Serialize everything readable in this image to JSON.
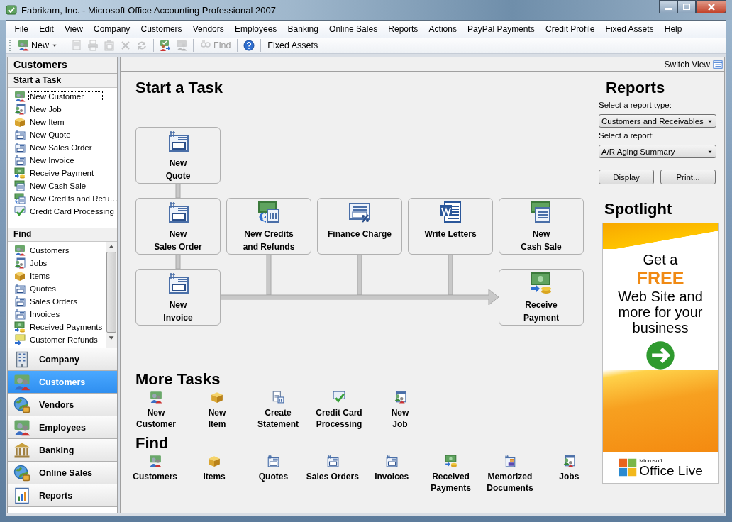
{
  "window": {
    "title": "Fabrikam, Inc. - Microsoft Office Accounting Professional 2007"
  },
  "menu": [
    "File",
    "Edit",
    "View",
    "Company",
    "Customers",
    "Vendors",
    "Employees",
    "Banking",
    "Online Sales",
    "Reports",
    "Actions",
    "PayPal Payments",
    "Credit Profile",
    "Fixed Assets",
    "Help"
  ],
  "toolbar": [
    {
      "kind": "button",
      "label": "New",
      "dropdown": true,
      "disabled": false
    },
    {
      "kind": "separator"
    },
    {
      "kind": "icon",
      "disabled": true
    },
    {
      "kind": "icon",
      "disabled": true
    },
    {
      "kind": "icon",
      "disabled": true
    },
    {
      "kind": "icon",
      "disabled": true
    },
    {
      "kind": "icon",
      "disabled": true
    },
    {
      "kind": "separator"
    },
    {
      "kind": "icon",
      "disabled": false
    },
    {
      "kind": "icon",
      "disabled": true
    },
    {
      "kind": "separator"
    },
    {
      "kind": "button",
      "label": "Find",
      "dropdown": false,
      "disabled": true
    },
    {
      "kind": "separator"
    },
    {
      "kind": "icon",
      "disabled": false
    },
    {
      "kind": "separator"
    },
    {
      "kind": "button",
      "label": "Fixed Assets",
      "dropdown": false,
      "disabled": false
    }
  ],
  "sidebar": {
    "title": "Customers",
    "start_a_task": {
      "heading": "Start a Task",
      "items": [
        {
          "label": "New Customer",
          "selected": true
        },
        {
          "label": "New Job",
          "selected": false
        },
        {
          "label": "New Item",
          "selected": false
        },
        {
          "label": "New Quote",
          "selected": false
        },
        {
          "label": "New Sales Order",
          "selected": false
        },
        {
          "label": "New Invoice",
          "selected": false
        },
        {
          "label": "Receive Payment",
          "selected": false
        },
        {
          "label": "New Cash Sale",
          "selected": false
        },
        {
          "label": "New Credits and Refu…",
          "selected": false
        },
        {
          "label": "Credit Card Processing",
          "selected": false
        }
      ]
    },
    "find": {
      "heading": "Find",
      "items": [
        "Customers",
        "Jobs",
        "Items",
        "Quotes",
        "Sales Orders",
        "Invoices",
        "Received Payments",
        "Customer Refunds"
      ]
    },
    "nav": [
      {
        "label": "Company",
        "selected": false
      },
      {
        "label": "Customers",
        "selected": true
      },
      {
        "label": "Vendors",
        "selected": false
      },
      {
        "label": "Employees",
        "selected": false
      },
      {
        "label": "Banking",
        "selected": false
      },
      {
        "label": "Online Sales",
        "selected": false
      },
      {
        "label": "Reports",
        "selected": false
      }
    ]
  },
  "main": {
    "switch_view": "Switch View",
    "start_a_task": {
      "heading": "Start a Task",
      "tasks": [
        {
          "lines": [
            "New",
            "Quote"
          ]
        },
        {
          "lines": [
            "New",
            "Sales Order"
          ]
        },
        {
          "lines": [
            "New Credits",
            "and Refunds"
          ]
        },
        {
          "lines": [
            "Finance Charge"
          ]
        },
        {
          "lines": [
            "Write Letters"
          ]
        },
        {
          "lines": [
            "New",
            "Cash Sale"
          ]
        },
        {
          "lines": [
            "New",
            "Invoice"
          ]
        },
        {
          "lines": [
            "Receive",
            "Payment"
          ]
        }
      ]
    },
    "more_tasks": {
      "heading": "More Tasks",
      "items": [
        {
          "lines": [
            "New",
            "Customer"
          ]
        },
        {
          "lines": [
            "New",
            "Item"
          ]
        },
        {
          "lines": [
            "Create",
            "Statement"
          ]
        },
        {
          "lines": [
            "Credit Card",
            "Processing"
          ]
        },
        {
          "lines": [
            "New",
            "Job"
          ]
        }
      ]
    },
    "find": {
      "heading": "Find",
      "items": [
        {
          "lines": [
            "Customers"
          ]
        },
        {
          "lines": [
            "Items"
          ]
        },
        {
          "lines": [
            "Quotes"
          ]
        },
        {
          "lines": [
            "Sales Orders"
          ]
        },
        {
          "lines": [
            "Invoices"
          ]
        },
        {
          "lines": [
            "Received",
            "Payments"
          ]
        },
        {
          "lines": [
            "Memorized",
            "Documents"
          ]
        },
        {
          "lines": [
            "Jobs"
          ]
        }
      ]
    }
  },
  "reports": {
    "heading": "Reports",
    "type_label": "Select a report type:",
    "type_value": "Customers and Receivables",
    "report_label": "Select a report:",
    "report_value": "A/R Aging Summary",
    "buttons": [
      "Display",
      "Print..."
    ]
  },
  "spotlight": {
    "heading": "Spotlight",
    "ad": {
      "line_1": "Get a",
      "highlight": "FREE",
      "body": "Web Site and more for your business",
      "brand_small": "Microsoft",
      "brand": "Office Live"
    }
  }
}
